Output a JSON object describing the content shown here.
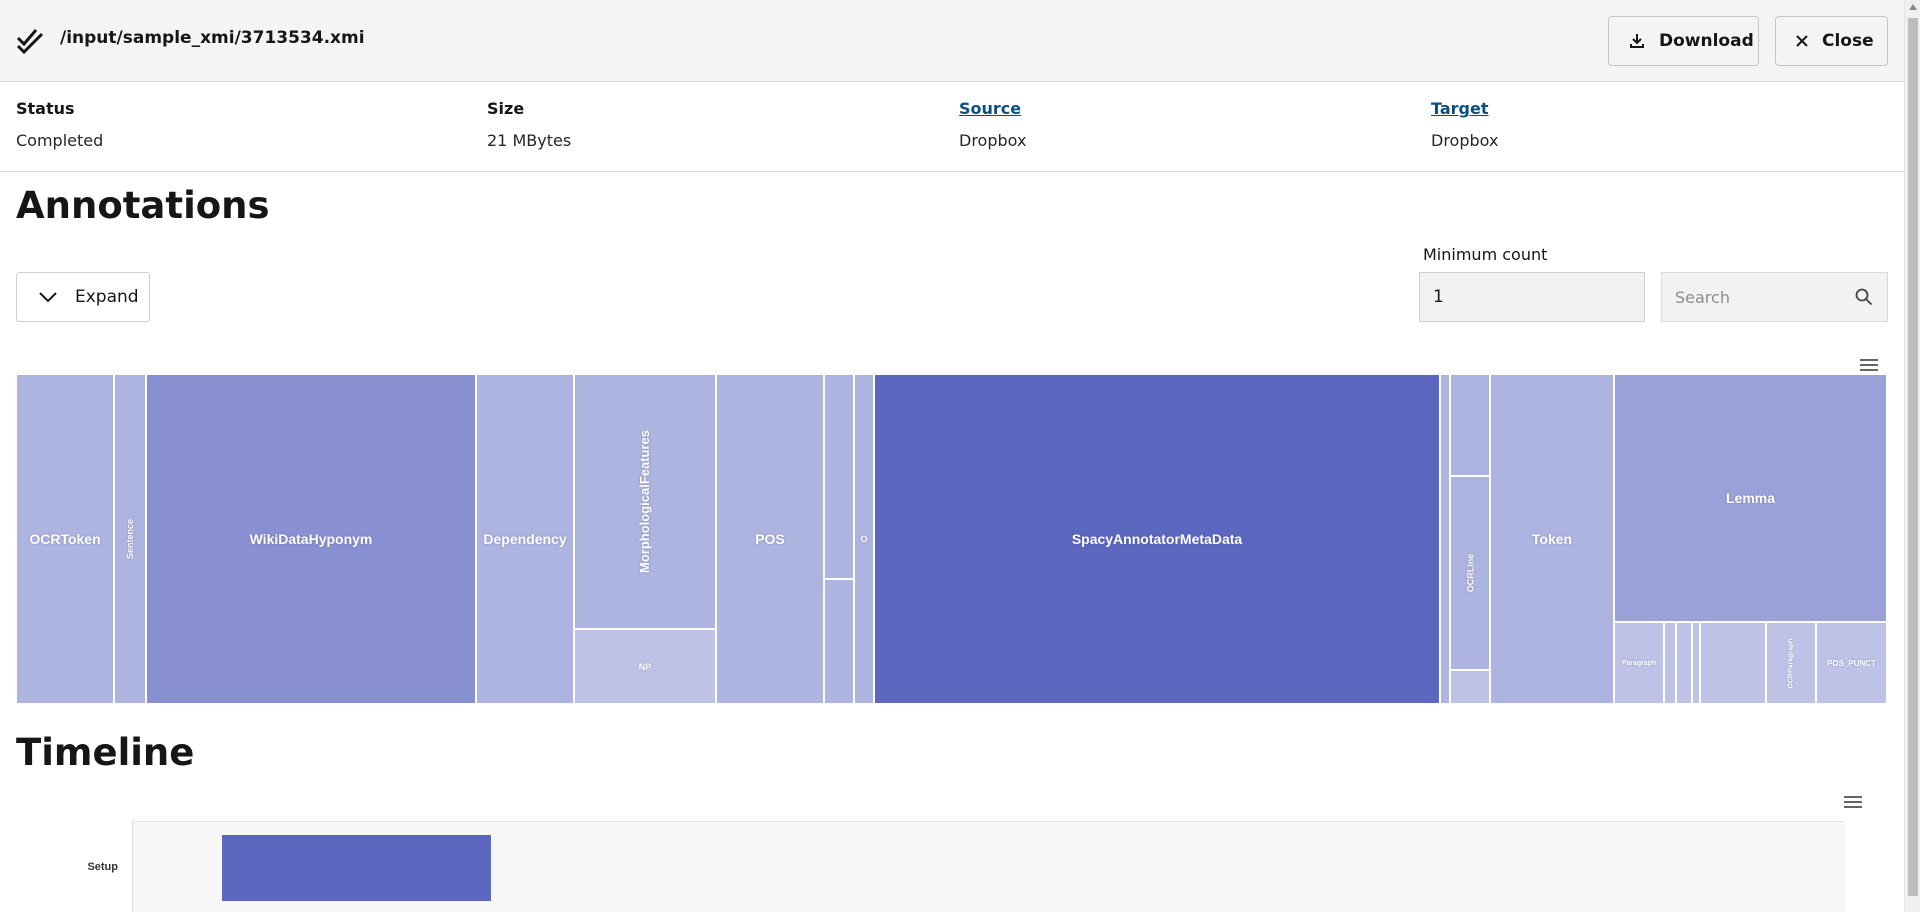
{
  "header": {
    "title": "/input/sample_xmi/3713534.xmi",
    "download_label": "Download",
    "close_label": "Close"
  },
  "info": {
    "status_label": "Status",
    "status_value": "Completed",
    "size_label": "Size",
    "size_value": "21 MBytes",
    "source_label": "Source",
    "source_value": "Dropbox",
    "target_label": "Target",
    "target_value": "Dropbox"
  },
  "annotations": {
    "heading": "Annotations",
    "expand_label": "Expand",
    "min_count_label": "Minimum count",
    "min_count_value": "1",
    "search_placeholder": "Search"
  },
  "timeline": {
    "heading": "Timeline",
    "rows": [
      {
        "label": "Setup"
      }
    ]
  },
  "colors": {
    "treemap_dark": "#5c67c0",
    "treemap_medium": "#8990d2",
    "treemap_light": "#aeb4e0",
    "treemap_lighter": "#bdc2e6",
    "header_bg": "#f4f4f4",
    "link": "#0b4f7f"
  },
  "icons": {
    "header": "double-check-icon",
    "download": "download-icon",
    "close": "close-icon",
    "expand": "chevron-down-icon",
    "search": "search-icon",
    "chart_menu": "hamburger-menu-icon"
  },
  "treemap_labels": {
    "ocrtoken": "OCRToken",
    "sentence": "Sentence",
    "wikidatahyponym": "WikiDataHyponym",
    "dependency": "Dependency",
    "morphologicalfeatures": "MorphologicalFeatures",
    "np": "NP",
    "pos": "POS",
    "o": "O",
    "spacyannotatormetadata": "SpacyAnnotatorMetaData",
    "ocrline": "OCRLine",
    "token": "Token",
    "lemma": "Lemma",
    "paragraph": "Paragraph",
    "ocrparagraph": "OCRParagraph",
    "pos_punct": "POS_PUNCT"
  }
}
